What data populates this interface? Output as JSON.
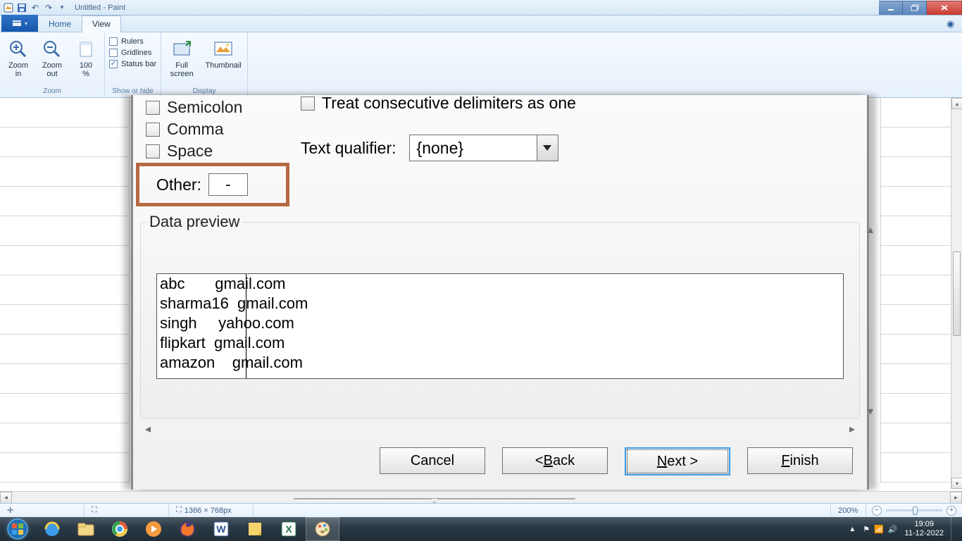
{
  "window": {
    "title": "Untitled - Paint"
  },
  "ribbon": {
    "file_label": "",
    "tabs": {
      "home": "Home",
      "view": "View"
    },
    "zoom": {
      "in": "Zoom\nin",
      "out": "Zoom\nout",
      "hundred": "100\n%",
      "group": "Zoom"
    },
    "show": {
      "rulers": "Rulers",
      "gridlines": "Gridlines",
      "statusbar": "Status bar",
      "group": "Show or hide"
    },
    "display": {
      "full": "Full\nscreen",
      "thumb": "Thumbnail",
      "group": "Display"
    }
  },
  "dialog": {
    "delimiters": {
      "semicolon": "Semicolon",
      "comma": "Comma",
      "space": "Space",
      "other": "Other:",
      "other_value": "-"
    },
    "consecutive": "Treat consecutive delimiters as one",
    "text_qualifier_label": "Text qualifier:",
    "text_qualifier_value": "{none}",
    "preview_label": "Data preview",
    "preview_rows": [
      {
        "c1": "abc",
        "c2": "gmail.com"
      },
      {
        "c1": "sharma16",
        "c2": "gmail.com"
      },
      {
        "c1": "singh",
        "c2": "yahoo.com"
      },
      {
        "c1": "flipkart",
        "c2": "gmail.com"
      },
      {
        "c1": "amazon",
        "c2": "gmail.com"
      }
    ],
    "buttons": {
      "cancel": "Cancel",
      "back": "< Back",
      "next": "Next >",
      "finish": "Finish"
    }
  },
  "statusbar": {
    "dims": "1366 × 768px",
    "zoom": "200%"
  },
  "taskbar": {
    "time": "19:09",
    "date": "11-12-2022"
  }
}
